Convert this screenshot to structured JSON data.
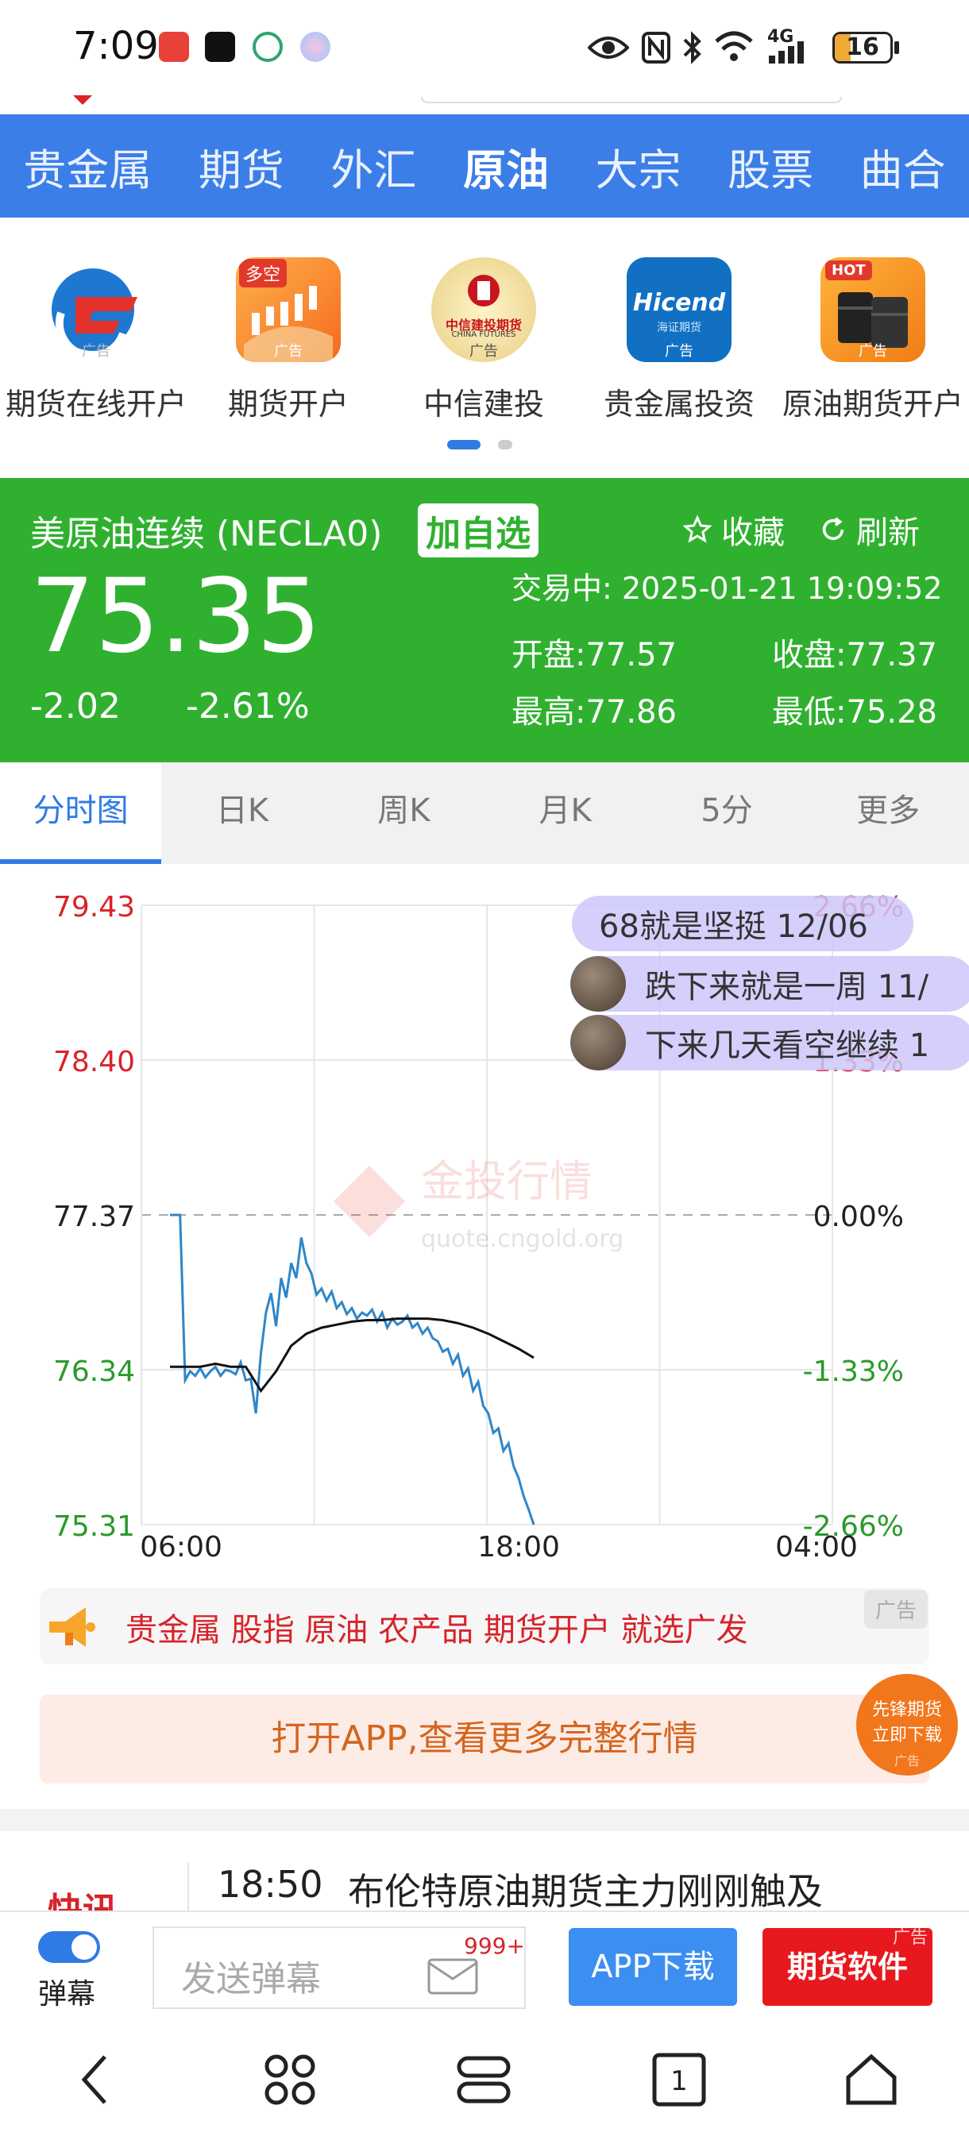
{
  "status_bar": {
    "time": "7:09",
    "network": "4G",
    "battery": "16"
  },
  "nav": {
    "items": [
      "贵金属",
      "期货",
      "外汇",
      "原油",
      "大宗",
      "股票",
      "曲合"
    ],
    "active_index": 3
  },
  "ads": {
    "items": [
      {
        "label": "期货在线开户",
        "tag": "广告",
        "icon": "gf-logo-icon"
      },
      {
        "label": "期货开户",
        "tag": "广告",
        "badge": "多空",
        "icon": "candlestick-icon"
      },
      {
        "label": "中信建投",
        "tag": "广告",
        "logo_text": "中信建投期货",
        "logo_sub": "CHINA FUTURES",
        "icon": "citic-logo-icon"
      },
      {
        "label": "贵金属投资",
        "tag": "广告",
        "logo_text": "Hicend",
        "logo_sub": "海证期货",
        "icon": "hicend-logo-icon"
      },
      {
        "label": "原油期货开户",
        "tag": "广告",
        "badge": "HOT",
        "icon": "oil-barrel-icon"
      }
    ]
  },
  "quote": {
    "name": "美原油连续 (NECLA0)",
    "add_watch": "加自选",
    "favorite": "收藏",
    "refresh": "刷新",
    "price": "75.35",
    "change": "-2.02",
    "change_pct": "-2.61%",
    "status": "交易中: 2025-01-21 19:09:52",
    "open": "开盘:77.57",
    "close": "收盘:77.37",
    "high": "最高:77.86",
    "low": "最低:75.28"
  },
  "tabs": [
    "分时图",
    "日K",
    "周K",
    "月K",
    "5分",
    "更多"
  ],
  "chart": {
    "watermark": "金投行情",
    "watermark_url": "quote.cngold.org",
    "danmu": [
      {
        "text": "68就是坚挺 12/06"
      },
      {
        "text": "跌下来就是一周 11/"
      },
      {
        "text": "下来几天看空继续 1"
      }
    ]
  },
  "chart_data": {
    "type": "line",
    "y_ticks": [
      "79.43",
      "78.40",
      "77.37",
      "76.34",
      "75.31"
    ],
    "pct_ticks": [
      "2.66%",
      "1.33%",
      "0.00%",
      "-1.33%",
      "-2.66%"
    ],
    "x_ticks": [
      "06:00",
      "18:00",
      "04:00"
    ],
    "ylim": [
      75.31,
      79.43
    ],
    "prev_close": 77.37,
    "up_color": "#d8232a",
    "down_color": "#2a9a2a",
    "series": [
      {
        "role": "price",
        "color": "#2f86c9",
        "values": [
          77.37,
          77.37,
          77.37,
          76.27,
          76.33,
          76.3,
          76.35,
          76.29,
          76.33,
          76.36,
          76.3,
          76.34,
          76.33,
          76.31,
          76.39,
          76.27,
          76.28,
          76.05,
          76.45,
          76.72,
          76.85,
          76.63,
          76.95,
          76.82,
          77.05,
          76.95,
          77.22,
          77.05,
          76.98,
          76.84,
          76.88,
          76.8,
          76.86,
          76.75,
          76.79,
          76.71,
          76.75,
          76.68,
          76.72,
          76.7,
          76.74,
          76.66,
          76.72,
          76.62,
          76.68,
          76.64,
          76.66,
          76.7,
          76.62,
          76.65,
          76.58,
          76.62,
          76.55,
          76.53,
          76.46,
          76.48,
          76.38,
          76.44,
          76.3,
          76.35,
          76.2,
          76.26,
          76.1,
          76.05,
          75.92,
          75.95,
          75.8,
          75.85,
          75.7,
          75.62,
          75.5,
          75.41,
          75.31
        ]
      },
      {
        "role": "average",
        "color": "#111111",
        "values": [
          76.36,
          76.36,
          76.36,
          76.38,
          76.36,
          76.36,
          76.2,
          76.33,
          76.5,
          76.58,
          76.62,
          76.64,
          76.66,
          76.67,
          76.67,
          76.68,
          76.68,
          76.68,
          76.67,
          76.65,
          76.62,
          76.58,
          76.53,
          76.48,
          76.42
        ]
      }
    ]
  },
  "ad_bar": {
    "text": "贵金属 股指 原油 农产品 期货开户 就选广发",
    "tag": "广告"
  },
  "open_app": {
    "text": "打开APP,查看更多完整行情"
  },
  "pioneer": {
    "line1": "先锋期货",
    "line2": "立即下载",
    "tag": "广告"
  },
  "news": {
    "label": "快讯",
    "time": "18:50",
    "headline": "布伦特原油期货主力刚刚触及"
  },
  "bottom_bar": {
    "danmu_label": "弹幕",
    "send_placeholder": "发送弹幕",
    "badge": "999+",
    "app_download": "APP下载",
    "futures_software": "期货软件",
    "futures_tag": "广告"
  },
  "system_nav": {
    "tab_count": "1"
  }
}
